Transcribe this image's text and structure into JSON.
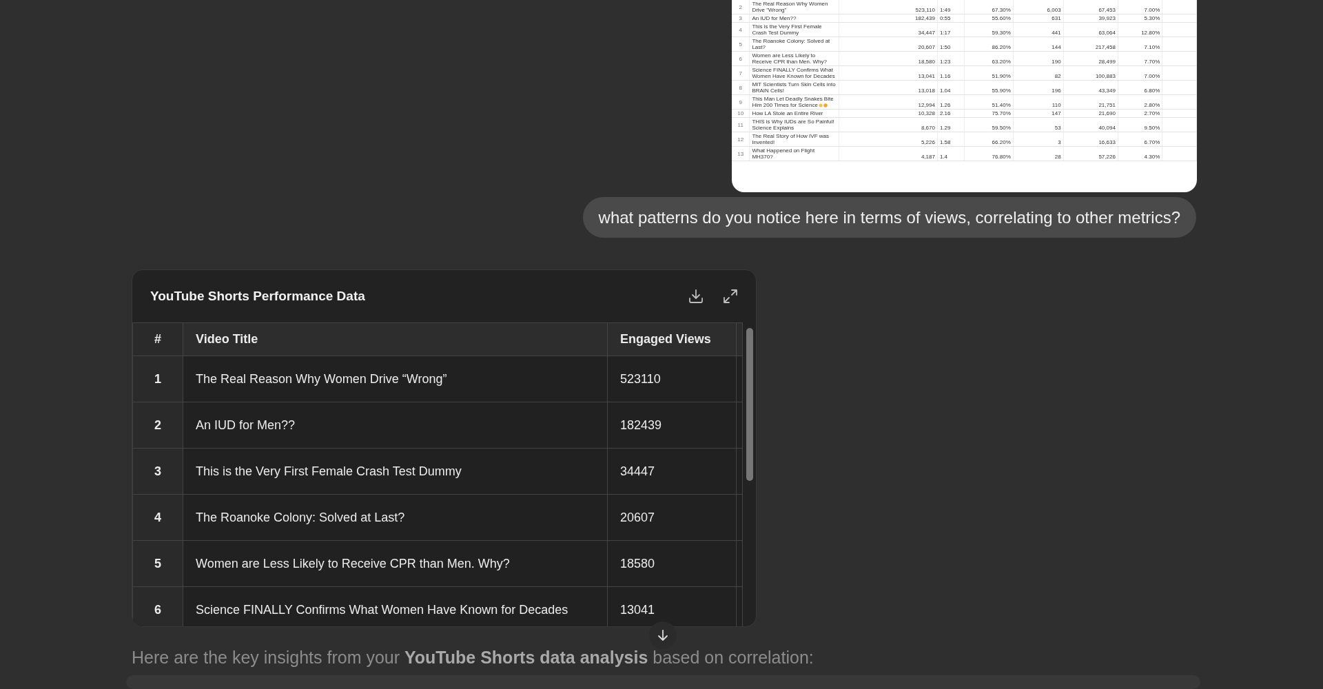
{
  "spreadsheet_image": {
    "rows": [
      {
        "cells": [
          "2",
          "The Real Reason Why Women Drive \"Wrong\"",
          "523,110",
          "1:49",
          "67.30%",
          "6,003",
          "67,453",
          "7.00%"
        ],
        "has_emoji": false
      },
      {
        "cells": [
          "3",
          "An IUD for Men??",
          "182,439",
          "0:55",
          "55.60%",
          "631",
          "39,923",
          "5.30%"
        ],
        "has_emoji": false
      },
      {
        "cells": [
          "4",
          "This is the Very First Female Crash Test Dummy",
          "34,447",
          "1:17",
          "59.30%",
          "441",
          "63,064",
          "12.80%"
        ],
        "has_emoji": false
      },
      {
        "cells": [
          "5",
          "The Roanoke Colony: Solved at Last?",
          "20,607",
          "1:50",
          "86.20%",
          "144",
          "217,458",
          "7.10%"
        ],
        "has_emoji": false
      },
      {
        "cells": [
          "6",
          "Women are Less Likely to Receive CPR than Men. Why?",
          "18,580",
          "1:23",
          "63.20%",
          "190",
          "28,499",
          "7.70%"
        ],
        "has_emoji": false
      },
      {
        "cells": [
          "7",
          "Science FINALLY Confirms What Women Have Known for Decades",
          "13,041",
          "1.16",
          "51.90%",
          "82",
          "100,883",
          "7.00%"
        ],
        "has_emoji": false
      },
      {
        "cells": [
          "8",
          "MIT Scientists Turn Skin Cells into BRAIN Cells!",
          "13,018",
          "1.04",
          "55.90%",
          "196",
          "43,349",
          "6.80%"
        ],
        "has_emoji": false
      },
      {
        "cells": [
          "9",
          "This Man Let Deadly Snakes Bite Him 200 Times for Science",
          "12,994",
          "1.26",
          "51.40%",
          "110",
          "21,751",
          "2.80%"
        ],
        "has_emoji": true
      },
      {
        "cells": [
          "10",
          "How LA Stole an Entire River",
          "10,328",
          "2.16",
          "75.70%",
          "147",
          "21,690",
          "2.70%"
        ],
        "has_emoji": false
      },
      {
        "cells": [
          "11",
          "THIS is Why IUDs are So Painful! Science Explains",
          "8,670",
          "1.29",
          "59.50%",
          "53",
          "40,094",
          "9.50%"
        ],
        "has_emoji": false
      },
      {
        "cells": [
          "12",
          "The Real Story of How IVF was Invented!",
          "5,226",
          "1.58",
          "66.20%",
          "3",
          "16,633",
          "6.70%"
        ],
        "has_emoji": false
      },
      {
        "cells": [
          "13",
          "What Happened on Flight MH370?",
          "4,187",
          "1.4",
          "76.80%",
          "28",
          "57,226",
          "4.30%"
        ],
        "has_emoji": false
      }
    ]
  },
  "user_message": "what patterns do you notice here in terms of views, correlating to other metrics?",
  "data_card": {
    "title": "YouTube Shorts Performance Data",
    "columns": [
      "#",
      "Video Title",
      "Engaged Views"
    ],
    "rows": [
      {
        "num": "1",
        "title": "The Real Reason Why Women Drive “Wrong”",
        "views": "523110"
      },
      {
        "num": "2",
        "title": "An IUD for Men??",
        "views": "182439"
      },
      {
        "num": "3",
        "title": "This is the Very First Female Crash Test Dummy",
        "views": "34447"
      },
      {
        "num": "4",
        "title": "The Roanoke Colony: Solved at Last?",
        "views": "20607"
      },
      {
        "num": "5",
        "title": "Women are Less Likely to Receive CPR than Men. Why?",
        "views": "18580"
      },
      {
        "num": "6",
        "title": "Science FINALLY Confirms What Women Have Known for Decades",
        "views": "13041"
      }
    ]
  },
  "reply_text": "Here are the key insights from your **YouTube Shorts data analysis** based on correlation:"
}
